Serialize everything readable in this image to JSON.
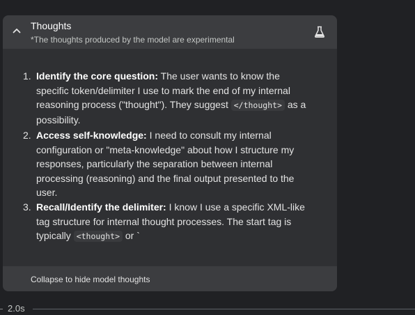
{
  "thoughts_panel": {
    "title": "Thoughts",
    "subtitle": "*The thoughts produced by the model are experimental",
    "collapse_icon": "chevron-up-icon",
    "badge_icon": "flask-icon",
    "items": [
      {
        "number": "1.",
        "heading": "Identify the core question:",
        "lines": [
          " The user wants to know the",
          "specific token/delimiter I use to mark the end of my internal",
          "reasoning process (\"thought\"). They suggest "
        ],
        "code": "</thought>",
        "tail": [
          " as a",
          "possibility."
        ]
      },
      {
        "number": "2.",
        "heading": "Access self-knowledge:",
        "lines": [
          " I need to consult my internal",
          "configuration or \"meta-knowledge\" about how I structure my",
          "responses, particularly the separation between internal",
          "processing (reasoning) and the final output presented to the",
          "user."
        ]
      },
      {
        "number": "3.",
        "heading": "Recall/Identify the delimiter:",
        "lines": [
          " I know I use a specific XML-like",
          "tag structure for internal thought processes. The start tag is",
          "typically "
        ],
        "code": "<thought>",
        "tail": [
          " or `"
        ]
      }
    ],
    "footer_label": "Collapse to hide model thoughts"
  },
  "elapsed": "2.0s"
}
